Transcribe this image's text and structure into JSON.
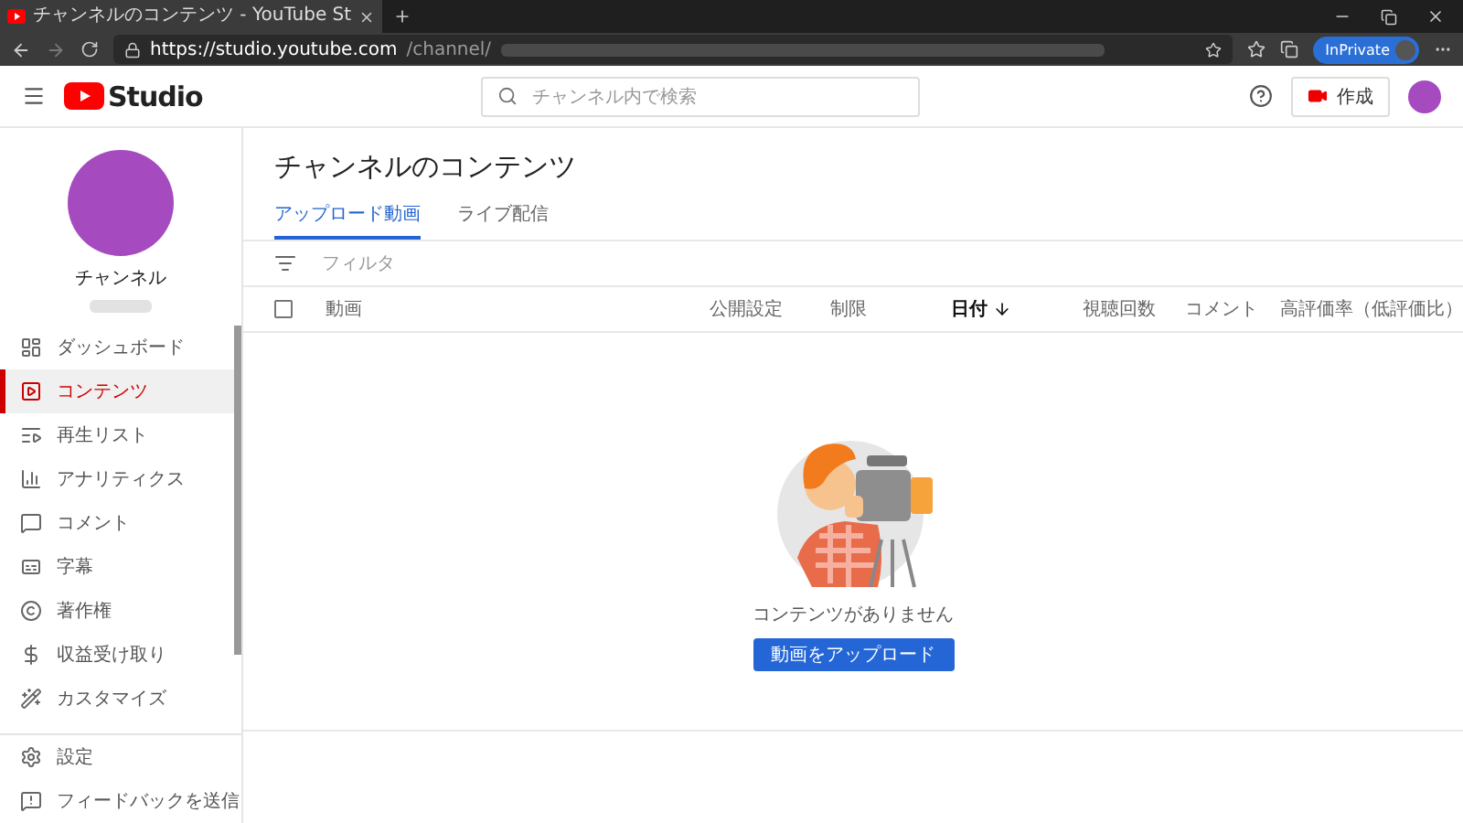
{
  "browser": {
    "tab": {
      "title": "チャンネルのコンテンツ - YouTube St"
    },
    "address": {
      "host": "https://studio.youtube.com",
      "path": "/channel/"
    },
    "inprivate": "InPrivate"
  },
  "header": {
    "logo": "Studio",
    "search": {
      "placeholder": "チャンネル内で検索"
    },
    "create": "作成"
  },
  "sidebar": {
    "channel_name": "チャンネル",
    "items": [
      {
        "label": "ダッシュボード",
        "selected": false
      },
      {
        "label": "コンテンツ",
        "selected": true
      },
      {
        "label": "再生リスト",
        "selected": false
      },
      {
        "label": "アナリティクス",
        "selected": false
      },
      {
        "label": "コメント",
        "selected": false
      },
      {
        "label": "字幕",
        "selected": false
      },
      {
        "label": "著作権",
        "selected": false
      },
      {
        "label": "収益受け取り",
        "selected": false
      },
      {
        "label": "カスタマイズ",
        "selected": false
      }
    ],
    "footer": [
      {
        "label": "設定"
      },
      {
        "label": "フィードバックを送信"
      }
    ]
  },
  "page": {
    "title": "チャンネルのコンテンツ",
    "tabs": [
      {
        "label": "アップロード動画",
        "selected": true
      },
      {
        "label": "ライブ配信",
        "selected": false
      }
    ],
    "filter": {
      "placeholder": "フィルタ"
    },
    "select_all": {
      "checked": false
    },
    "columns": [
      {
        "label": "動画",
        "sorted": false
      },
      {
        "label": "公開設定",
        "sorted": false
      },
      {
        "label": "制限",
        "sorted": false
      },
      {
        "label": "日付",
        "sorted": true
      },
      {
        "label": "視聴回数",
        "sorted": false
      },
      {
        "label": "コメント",
        "sorted": false
      },
      {
        "label": "高評価率（低評価比）",
        "sorted": false
      }
    ],
    "empty": {
      "message": "コンテンツがありません",
      "button": "動画をアップロード"
    }
  }
}
